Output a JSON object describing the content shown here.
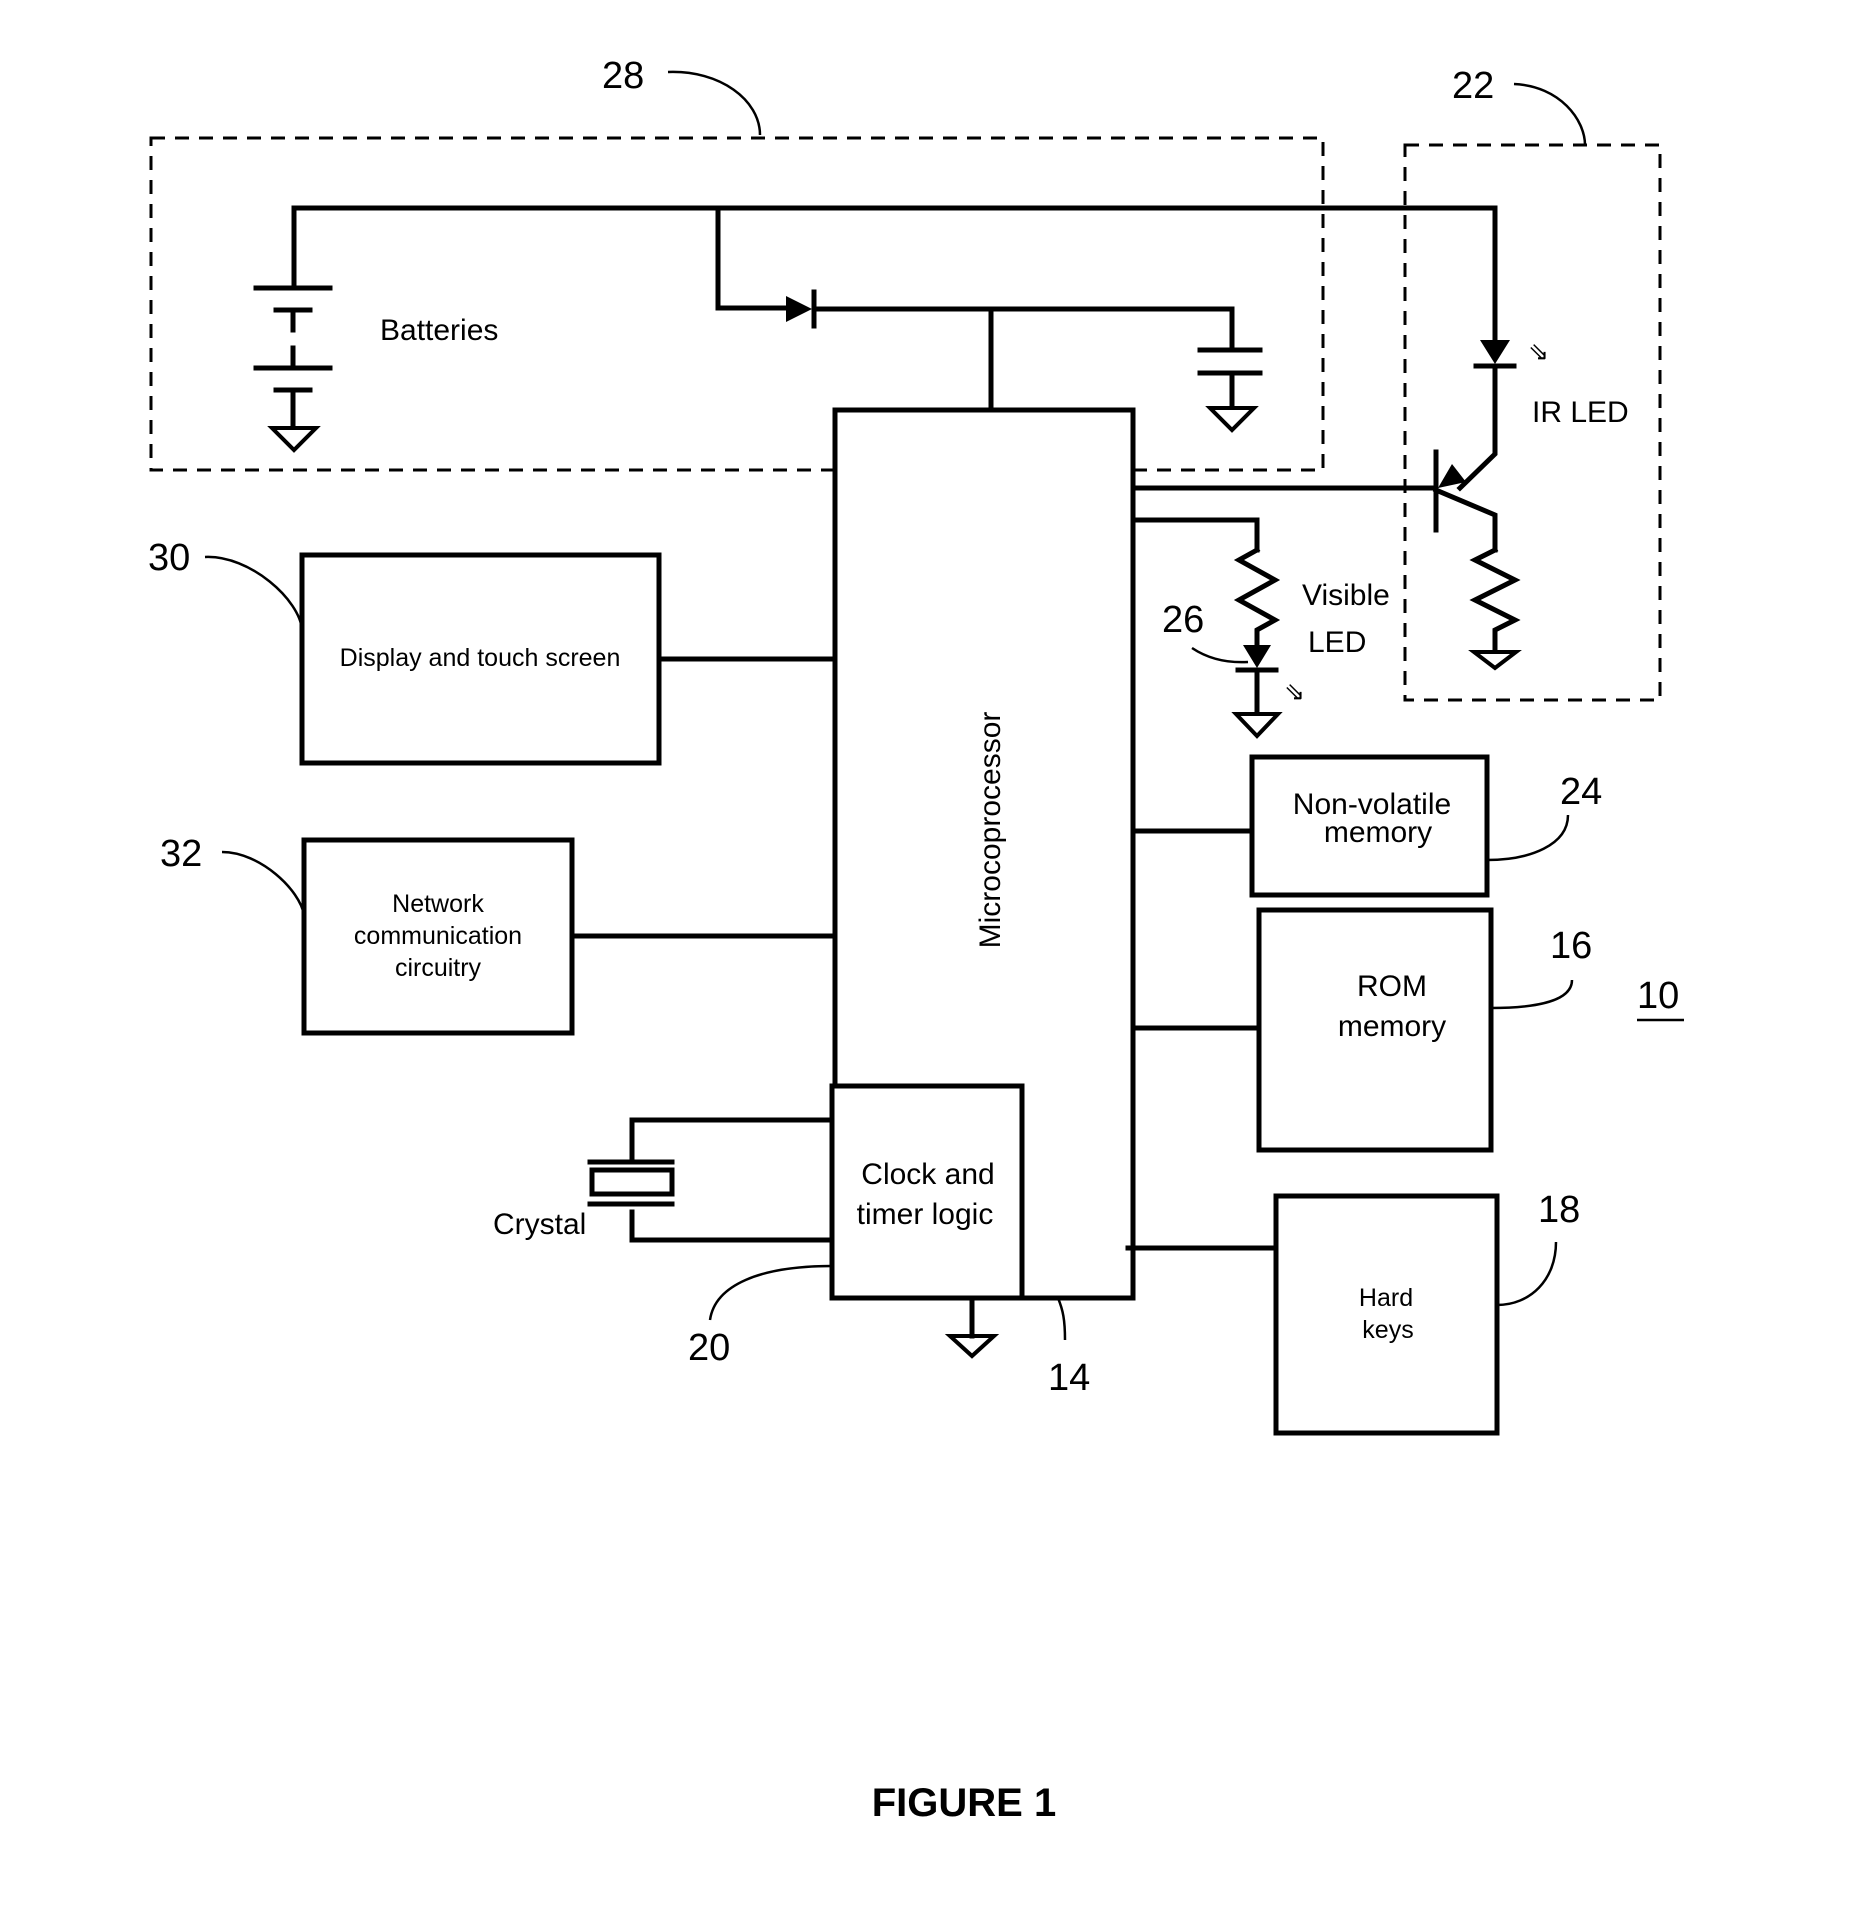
{
  "figure": {
    "caption": "FIGURE 1",
    "device_ref": "10"
  },
  "blocks": {
    "batteries": {
      "label": "Batteries",
      "ref": "28"
    },
    "ir_led": {
      "label": "IR LED",
      "ref": "22"
    },
    "visible_led": {
      "label_line1": "Visible",
      "label_line2": "LED",
      "ref": "26"
    },
    "display": {
      "label": "Display and touch screen",
      "ref": "30"
    },
    "network": {
      "label_line1": "Network",
      "label_line2": "communication",
      "label_line3": "circuitry",
      "ref": "32"
    },
    "microprocessor": {
      "label": "Microcoprocessor",
      "ref": "14"
    },
    "clock": {
      "label_line1": "Clock and",
      "label_line2": "timer logic",
      "ref": "20"
    },
    "crystal": {
      "label": "Crystal"
    },
    "nonvolatile": {
      "label_line1": "Non-volatile",
      "label_line2": "memory",
      "ref": "24"
    },
    "rom": {
      "label_line1": "ROM",
      "label_line2": "memory",
      "ref": "16"
    },
    "hardkeys": {
      "label_line1": "Hard",
      "label_line2": "keys",
      "ref": "18"
    }
  }
}
